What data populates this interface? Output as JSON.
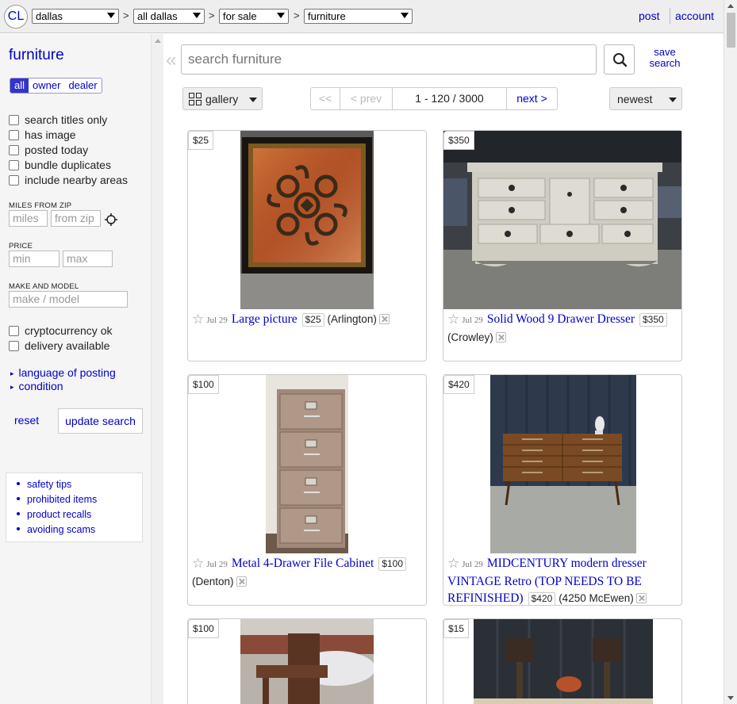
{
  "header": {
    "logo": "CL",
    "area": "dallas",
    "subarea": "all dallas",
    "section": "for sale",
    "category": "furniture",
    "separator": ">",
    "post": "post",
    "account": "account"
  },
  "sidebar": {
    "title": "furniture",
    "tabs": [
      "all",
      "owner",
      "dealer"
    ],
    "checkboxes1": [
      "search titles only",
      "has image",
      "posted today",
      "bundle duplicates",
      "include nearby areas"
    ],
    "miles_label": "MILES FROM ZIP",
    "miles_placeholder": "miles",
    "zip_placeholder": "from zip",
    "price_label": "PRICE",
    "min_placeholder": "min",
    "max_placeholder": "max",
    "make_label": "MAKE AND MODEL",
    "make_placeholder": "make / model",
    "checkboxes2": [
      "cryptocurrency ok",
      "delivery available"
    ],
    "expanders": [
      "language of posting",
      "condition"
    ],
    "reset": "reset",
    "update": "update search",
    "help_links": [
      "safety tips",
      "prohibited items",
      "product recalls",
      "avoiding scams"
    ]
  },
  "search": {
    "collapse_glyph": "«",
    "placeholder": "search furniture",
    "save_line1": "save",
    "save_line2": "search"
  },
  "toolbar": {
    "view": "gallery",
    "pager": [
      "<<",
      "< prev",
      "1 - 120 / 3000",
      "next >"
    ],
    "sort": "newest"
  },
  "listings": [
    {
      "price": "$25",
      "date": "Jul 29",
      "title": "Large picture",
      "location": "(Arlington)"
    },
    {
      "price": "$350",
      "date": "Jul 29",
      "title": "Solid Wood 9 Drawer Dresser",
      "location": "(Crowley)"
    },
    {
      "price": "$100",
      "date": "Jul 29",
      "title": "Metal 4-Drawer File Cabinet",
      "location": "(Denton)"
    },
    {
      "price": "$420",
      "date": "Jul 29",
      "title": "MIDCENTURY modern dresser VINTAGE Retro (TOP NEEDS TO BE REFINISHED)",
      "location": "(4250 McEwen)"
    },
    {
      "price": "$100"
    },
    {
      "price": "$15"
    }
  ],
  "colors": {
    "link": "#0000cc",
    "sidebar_bg": "#f5f5f5",
    "topbar_bg": "#eeeeee"
  }
}
